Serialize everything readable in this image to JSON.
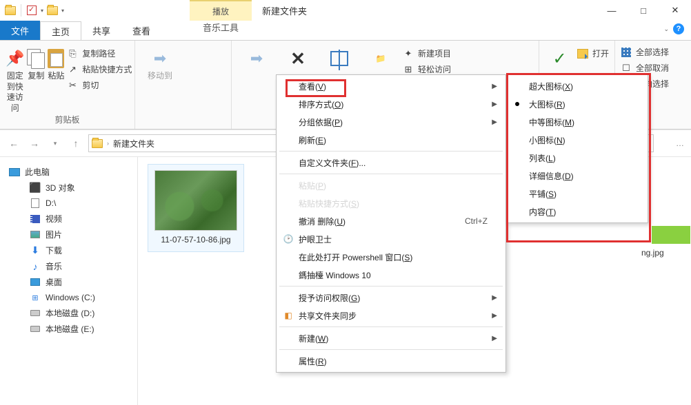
{
  "titlebar": {
    "context_tab": "播放",
    "title": "新建文件夹",
    "minimize": "—",
    "maximize": "□",
    "close": "✕"
  },
  "tabs": {
    "file": "文件",
    "home": "主页",
    "share": "共享",
    "view": "查看",
    "music_tools": "音乐工具"
  },
  "ribbon": {
    "pin": "固定到快速访问",
    "copy": "复制",
    "paste": "粘贴",
    "copy_path": "复制路径",
    "paste_shortcut": "粘贴快捷方式",
    "cut": "剪切",
    "clipboard_label": "剪贴板",
    "move_to": "移动到",
    "new_item": "新建项目",
    "easy_access": "轻松访问",
    "open": "打开",
    "select_all": "全部选择",
    "deselect": "全部取消",
    "invert": "反向选择"
  },
  "breadcrumb": {
    "folder": "新建文件夹",
    "sep": "›"
  },
  "sidebar": {
    "root": "此电脑",
    "items": [
      {
        "label": "3D 对象",
        "icon": "cube"
      },
      {
        "label": "D:\\",
        "icon": "doc"
      },
      {
        "label": "视频",
        "icon": "vid"
      },
      {
        "label": "图片",
        "icon": "img"
      },
      {
        "label": "下载",
        "icon": "dl"
      },
      {
        "label": "音乐",
        "icon": "music"
      },
      {
        "label": "桌面",
        "icon": "desk"
      },
      {
        "label": "Windows (C:)",
        "icon": "win"
      },
      {
        "label": "本地磁盘 (D:)",
        "icon": "disk"
      },
      {
        "label": "本地磁盘 (E:)",
        "icon": "disk"
      }
    ]
  },
  "content": {
    "file1": "11-07-57-10-86.jpg",
    "file_other": "ng.jpg"
  },
  "context_menu": {
    "view": "查看(<u>V</u>)",
    "sort": "排序方式(<u>O</u>)",
    "group": "分组依据(<u>P</u>)",
    "refresh": "刷新(<u>E</u>)",
    "customize": "自定义文件夹(<u>F</u>)...",
    "paste": "粘贴(<u>P</u>)",
    "paste_shortcut": "粘贴快捷方式(<u>S</u>)",
    "undo_delete": "撤消 删除(<u>U</u>)",
    "undo_shortcut": "Ctrl+Z",
    "eye_guard": "护眼卫士",
    "powershell": "在此处打开 Powershell 窗口(<u>S</u>)",
    "win10": "鎷抽檯 Windows 10",
    "grant_access": "授予访问权限(<u>G</u>)",
    "share_sync": "共享文件夹同步",
    "new": "新建(<u>W</u>)",
    "properties": "属性(<u>R</u>)"
  },
  "view_submenu": {
    "xl_icons": "超大图标(<u>X</u>)",
    "l_icons": "大图标(<u>R</u>)",
    "m_icons": "中等图标(<u>M</u>)",
    "s_icons": "小图标(<u>N</u>)",
    "list": "列表(<u>L</u>)",
    "details": "详细信息(<u>D</u>)",
    "tiles": "平铺(<u>S</u>)",
    "content": "内容(<u>T</u>)"
  }
}
